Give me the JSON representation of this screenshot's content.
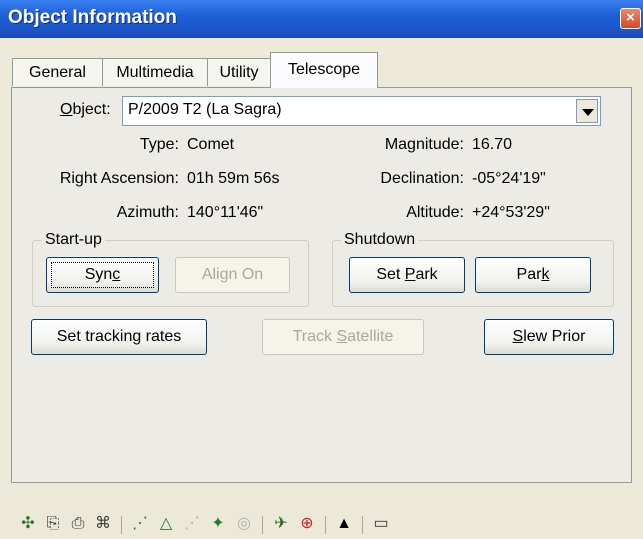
{
  "window": {
    "title": "Object Information",
    "close_glyph": "×"
  },
  "tabs": [
    {
      "label": "General",
      "active": false
    },
    {
      "label": "Multimedia",
      "active": false
    },
    {
      "label": "Utility",
      "active": false
    },
    {
      "label": "Telescope",
      "active": true
    }
  ],
  "object": {
    "label": "Object",
    "label_hotkey": "O",
    "label_rest": "bject",
    "value": "P/2009 T2 (La Sagra)"
  },
  "info": {
    "type_label": "Type:",
    "type_value": "Comet",
    "magnitude_label": "Magnitude:",
    "magnitude_value": "16.70",
    "ra_label": "Right Ascension:",
    "ra_value": "01h 59m 56s",
    "dec_label": "Declination:",
    "dec_value": "-05°24'19\"",
    "az_label": "Azimuth:",
    "az_value": "140°11'46\"",
    "alt_label": "Altitude:",
    "alt_value": "+24°53'29\""
  },
  "startup": {
    "title": "Start-up",
    "sync": {
      "pre": "Syn",
      "hot": "c",
      "post": ""
    },
    "align_on": "Align On"
  },
  "shutdown": {
    "title": "Shutdown",
    "set_park": {
      "pre": "Set ",
      "hot": "P",
      "post": "ark"
    },
    "park": {
      "pre": "Par",
      "hot": "k",
      "post": ""
    }
  },
  "actions": {
    "set_tracking": "Set tracking rates",
    "track_satellite": {
      "pre": "Track ",
      "hot": "S",
      "post": "atellite"
    },
    "slew_prior": {
      "pre": "",
      "hot": "S",
      "post": "lew Prior"
    }
  },
  "toolbar": {
    "icons": [
      {
        "name": "target-move-icon",
        "glyph": "✣",
        "color": "#2a6e2a"
      },
      {
        "name": "copy-icon",
        "glyph": "⎘",
        "color": "#3a3a3a"
      },
      {
        "name": "print-icon",
        "glyph": "⎙",
        "color": "#3a3a3a"
      },
      {
        "name": "book-icon",
        "glyph": "⌘",
        "color": "#3a3a3a"
      },
      {
        "name": "chart-dots-icon",
        "glyph": "⋰",
        "color": "#2a7a2a"
      },
      {
        "name": "chart-mountain-icon",
        "glyph": "△",
        "color": "#2a7a2a"
      },
      {
        "name": "chart-disabled-icon",
        "glyph": "⋰",
        "color": "#b0b0b0"
      },
      {
        "name": "chart-stars-icon",
        "glyph": "✦",
        "color": "#2a7a2a"
      },
      {
        "name": "orbit-disabled-icon",
        "glyph": "◎",
        "color": "#b0b0b0"
      },
      {
        "name": "telescope-icon",
        "glyph": "✈",
        "color": "#1f6e1f"
      },
      {
        "name": "target-red-icon",
        "glyph": "⊕",
        "color": "#c0262b"
      },
      {
        "name": "up-arrow-icon",
        "glyph": "▲",
        "color": "#000000"
      },
      {
        "name": "open-folder-icon",
        "glyph": "▭",
        "color": "#3a3a3a"
      }
    ]
  }
}
